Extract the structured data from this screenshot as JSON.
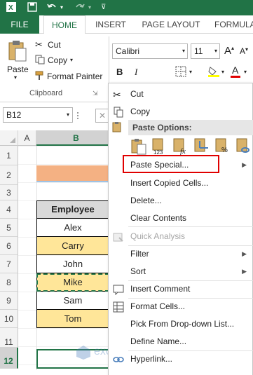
{
  "ribbon": {
    "tabs": [
      "FILE",
      "HOME",
      "INSERT",
      "PAGE LAYOUT",
      "FORMULA"
    ],
    "clipboard": {
      "paste_label": "Paste",
      "cut_label": "Cut",
      "copy_label": "Copy",
      "format_painter_label": "Format Painter",
      "group_label": "Clipboard"
    },
    "font": {
      "font_name": "Calibri",
      "font_size": "11",
      "bold_label": "B",
      "italic_label": "I",
      "increase_font_label": "A",
      "decrease_font_label": "A",
      "font_color_label": "A"
    }
  },
  "formula_bar": {
    "name_box": "B12"
  },
  "sheet": {
    "columns": [
      "A",
      "B"
    ],
    "rows": [
      "1",
      "2",
      "3",
      "4",
      "5",
      "6",
      "7",
      "8",
      "9",
      "10",
      "11",
      "12"
    ],
    "table": {
      "header": "Employee",
      "employees": [
        {
          "name": "Alex",
          "highlight": false
        },
        {
          "name": "Carry",
          "highlight": true
        },
        {
          "name": "John",
          "highlight": false
        },
        {
          "name": "Mike",
          "highlight": true
        },
        {
          "name": "Sam",
          "highlight": false
        },
        {
          "name": "Tom",
          "highlight": true
        }
      ]
    },
    "title_cell_fill": "#f4b183",
    "highlight_fill": "#ffe699",
    "watermark": "exceldemy"
  },
  "context_menu": {
    "cut": "Cut",
    "copy": "Copy",
    "paste_options_header": "Paste Options:",
    "paste_special": "Paste Special...",
    "insert_copied_cells": "Insert Copied Cells...",
    "delete": "Delete...",
    "clear_contents": "Clear Contents",
    "quick_analysis": "Quick Analysis",
    "filter": "Filter",
    "sort": "Sort",
    "insert_comment": "Insert Comment",
    "format_cells": "Format Cells...",
    "pick_from_dropdown": "Pick From Drop-down List...",
    "define_name": "Define Name...",
    "hyperlink": "Hyperlink..."
  },
  "colors": {
    "excel_green": "#217346",
    "highlight_box": "#e00000"
  }
}
